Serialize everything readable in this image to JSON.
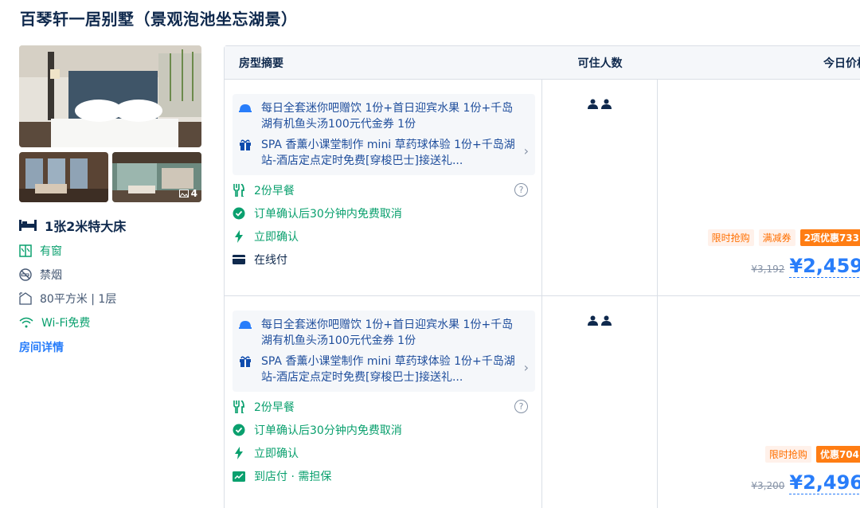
{
  "hotel_room_title": "百琴轩一居别墅（景观泡池坐忘湖景）",
  "left": {
    "photo_count": "4",
    "bed": "1张2米特大床",
    "features": [
      {
        "icon": "window-icon",
        "label": "有窗"
      },
      {
        "icon": "no-smoking-icon",
        "label": "禁烟"
      },
      {
        "icon": "area-icon",
        "label": "80平方米 | 1层"
      },
      {
        "icon": "wifi-icon",
        "label": "Wi-Fi免费"
      }
    ],
    "details_link": "房间详情"
  },
  "table": {
    "headers": {
      "summary": "房型摘要",
      "occupancy": "可住人数",
      "price": "今日价格"
    },
    "rows": [
      {
        "gifts": [
          {
            "icon": "service-bell-icon",
            "text": "每日全套迷你吧赠饮 1份+首日迎宾水果 1份+千岛湖有机鱼头汤100元代金券 1份"
          },
          {
            "icon": "gift-icon",
            "text": "SPA 香薰小课堂制作 mini 草药球体验 1份+千岛湖站-酒店定点定时免费[穿梭巴士]接送礼..."
          }
        ],
        "breakfast": "2份早餐",
        "cancel": "订单确认后30分钟内免费取消",
        "confirm": "立即确认",
        "payment": "在线付",
        "tags": [
          "限时抢购",
          "满减券",
          "2项优惠733"
        ],
        "old_price": "¥3,192",
        "new_price": "¥2,459"
      },
      {
        "gifts": [
          {
            "icon": "service-bell-icon",
            "text": "每日全套迷你吧赠饮 1份+首日迎宾水果 1份+千岛湖有机鱼头汤100元代金券 1份"
          },
          {
            "icon": "gift-icon",
            "text": "SPA 香薰小课堂制作 mini 草药球体验 1份+千岛湖站-酒店定点定时免费[穿梭巴士]接送礼..."
          }
        ],
        "breakfast": "2份早餐",
        "cancel": "订单确认后30分钟内免费取消",
        "confirm": "立即确认",
        "payment": "到店付 · 需担保",
        "tags": [
          "限时抢购",
          "优惠704"
        ],
        "old_price": "¥3,200",
        "new_price": "¥2,496"
      }
    ]
  },
  "colors": {
    "blue": "#287dfa",
    "green": "#0aa06e",
    "orange": "#ff7d13",
    "navy": "#0f294d"
  }
}
